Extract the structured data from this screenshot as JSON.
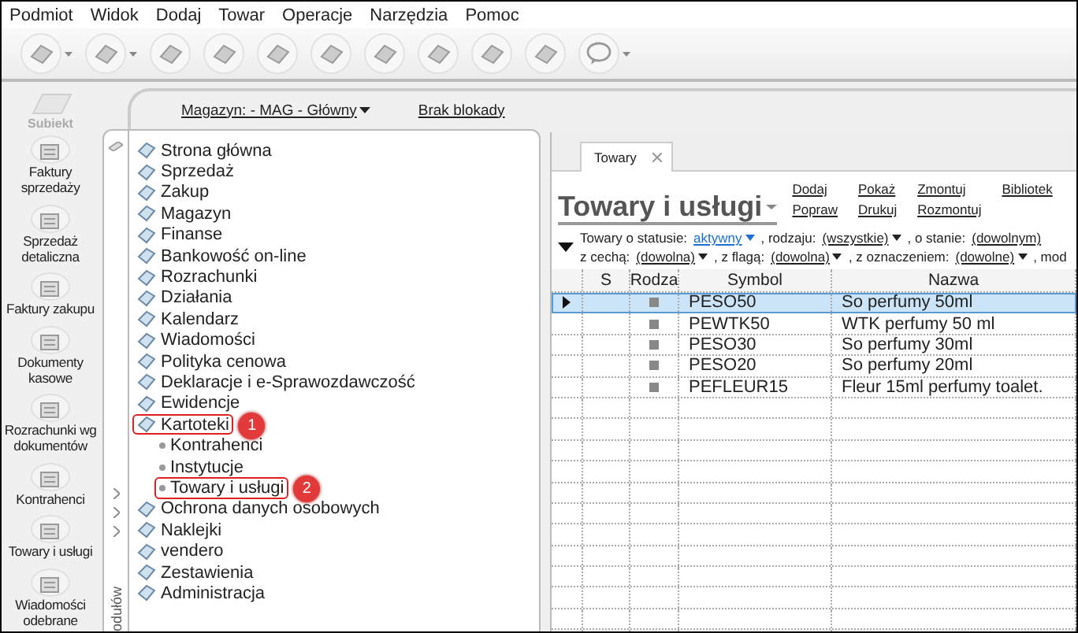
{
  "menu": [
    {
      "label": "Podmiot"
    },
    {
      "label": "Widok"
    },
    {
      "label": "Dodaj"
    },
    {
      "label": "Towar"
    },
    {
      "label": "Operacje"
    },
    {
      "label": "Narzędzia"
    },
    {
      "label": "Pomoc"
    }
  ],
  "toolbar": [
    {
      "menu": true
    },
    {
      "menu": true
    },
    {
      "menu": false
    },
    {
      "menu": false
    },
    {
      "menu": false
    },
    {
      "menu": false
    },
    {
      "menu": false
    },
    {
      "menu": false
    },
    {
      "menu": false
    },
    {
      "menu": false
    },
    {
      "menu": true
    }
  ],
  "header": {
    "warehouse": "Magazyn: - MAG - Główny",
    "lock_status": "Brak blokady"
  },
  "sidebar": {
    "logo": "Subiekt",
    "items": [
      {
        "label": "Faktury sprzedaży"
      },
      {
        "label": "Sprzedaż detaliczna"
      },
      {
        "label": "Faktury zakupu"
      },
      {
        "label": "Dokumenty kasowe"
      },
      {
        "label": "Rozrachunki wg dokumentów"
      },
      {
        "label": "Kontrahenci"
      },
      {
        "label": "Towary i usługi"
      },
      {
        "label": "Wiadomości odebrane"
      }
    ]
  },
  "modules": {
    "side_label": "odułów",
    "items": [
      {
        "label": "Strona główna"
      },
      {
        "label": "Sprzedaż"
      },
      {
        "label": "Zakup"
      },
      {
        "label": "Magazyn"
      },
      {
        "label": "Finanse"
      },
      {
        "label": "Bankowość on-line"
      },
      {
        "label": "Rozrachunki"
      },
      {
        "label": "Działania"
      },
      {
        "label": "Kalendarz"
      },
      {
        "label": "Wiadomości"
      },
      {
        "label": "Polityka cenowa"
      },
      {
        "label": "Deklaracje i e-Sprawozdawczość"
      },
      {
        "label": "Ewidencje"
      },
      {
        "label": "Kartoteki",
        "callout": "1",
        "children": [
          {
            "label": "Kontrahenci"
          },
          {
            "label": "Instytucje"
          },
          {
            "label": "Towary i usługi",
            "callout": "2"
          }
        ]
      },
      {
        "label": "Ochrona danych osobowych"
      },
      {
        "label": "Naklejki"
      },
      {
        "label": "vendero"
      },
      {
        "label": "Zestawienia"
      },
      {
        "label": "Administracja"
      }
    ]
  },
  "content": {
    "tab": {
      "label": "Towary",
      "closable": true
    },
    "title": "Towary i usługi",
    "actions": [
      {
        "links": [
          "Dodaj",
          "Popraw"
        ]
      },
      {
        "links": [
          "Pokaż",
          "Drukuj"
        ]
      },
      {
        "links": [
          "Zmontuj",
          "Rozmontuj"
        ]
      },
      {
        "links": [
          "Bibliotek"
        ]
      }
    ],
    "filters": [
      [
        {
          "kind": "label",
          "text": "Towary o statusie:"
        },
        {
          "kind": "value",
          "text": "aktywny",
          "color": "#1e6fd0",
          "dropdown": true
        },
        {
          "kind": "label",
          "text": ", rodzaju:"
        },
        {
          "kind": "value",
          "text": "(wszystkie)",
          "dropdown": true
        },
        {
          "kind": "label",
          "text": ", o stanie:"
        },
        {
          "kind": "value",
          "text": "(dowolnym)",
          "dropdown": false
        }
      ],
      [
        {
          "kind": "label",
          "text": "z cechą:"
        },
        {
          "kind": "value",
          "text": "(dowolna)",
          "dropdown": true
        },
        {
          "kind": "label",
          "text": ", z flagą:"
        },
        {
          "kind": "value",
          "text": "(dowolna)",
          "dropdown": true
        },
        {
          "kind": "label",
          "text": ", z oznaczeniem:"
        },
        {
          "kind": "value",
          "text": "(dowolne)",
          "dropdown": true
        },
        {
          "kind": "label",
          "text": ", mod"
        }
      ]
    ],
    "table": {
      "columns": [
        "S",
        "Rodza",
        "Symbol",
        "Nazwa"
      ],
      "rows": [
        {
          "kind": "goods",
          "symbol": "PESO50",
          "name": "So perfumy 50ml",
          "selected": true
        },
        {
          "kind": "goods",
          "symbol": "PEWTK50",
          "name": "WTK perfumy 50 ml",
          "selected": false
        },
        {
          "kind": "goods",
          "symbol": "PESO30",
          "name": "So perfumy 30ml",
          "selected": false
        },
        {
          "kind": "goods",
          "symbol": "PESO20",
          "name": "So perfumy 20ml",
          "selected": false
        },
        {
          "kind": "goods",
          "symbol": "PEFLEUR15",
          "name": "Fleur 15ml perfumy toalet.",
          "selected": false
        }
      ]
    }
  }
}
